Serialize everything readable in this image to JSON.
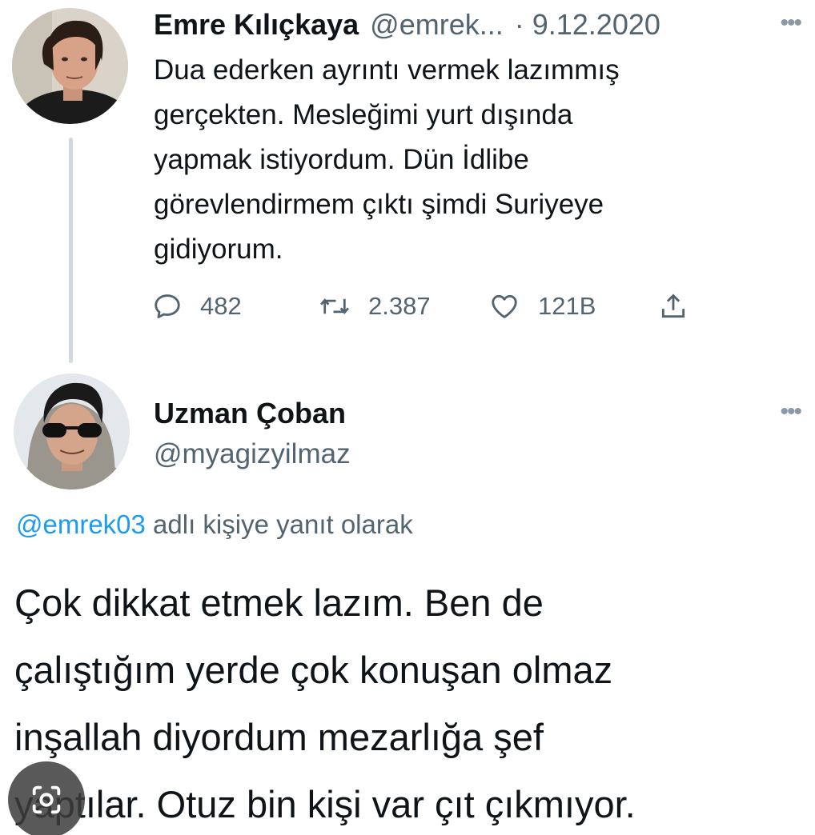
{
  "tweet1": {
    "name": "Emre Kılıçkaya",
    "handle": "@emrek...",
    "date": "· 9.12.2020",
    "lines": [
      "Dua ederken ayrıntı vermek lazımmış",
      "gerçekten. Mesleğimi yurt dışında",
      "yapmak istiyordum. Dün İdlibe",
      "görevlendirmem çıktı şimdi Suriyeye",
      "gidiyorum."
    ],
    "replies": "482",
    "retweets": "2.387",
    "likes": "121B"
  },
  "tweet2": {
    "name": "Uzman Çoban",
    "handle": "@myagizyilmaz",
    "reply_mention": "@emrek03",
    "reply_suffix": " adlı kişiye yanıt olarak",
    "lines": [
      "Çok dikkat etmek lazım. Ben de",
      "çalıştığım yerde çok konuşan olmaz",
      "inşallah diyordum mezarlığa şef",
      "yaptılar. Otuz bin kişi var çıt çıkmıyor."
    ]
  },
  "icons": {
    "reply": "speech-bubble-icon",
    "retweet": "retweet-icon",
    "like": "heart-icon",
    "share": "share-upload-icon",
    "more": "more-dots-icon",
    "lens": "lens-camera-icon"
  },
  "colors": {
    "text": "#0f1419",
    "secondary": "#536471",
    "link": "#1d9bf0",
    "thread_line": "#cfd9de"
  }
}
